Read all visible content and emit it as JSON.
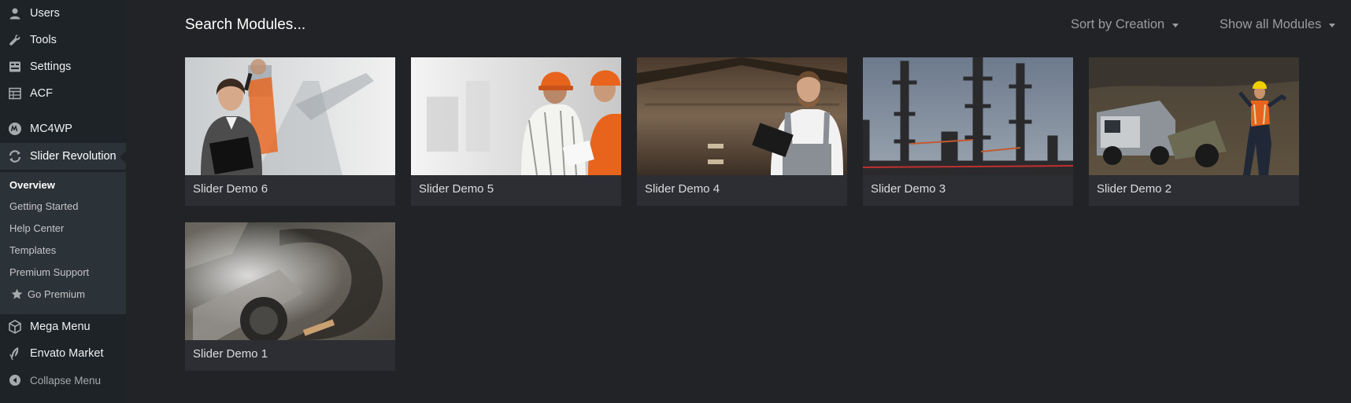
{
  "sidebar": {
    "items": [
      {
        "label": "Users",
        "icon": "user-icon"
      },
      {
        "label": "Tools",
        "icon": "wrench-icon"
      },
      {
        "label": "Settings",
        "icon": "settings-icon"
      },
      {
        "label": "ACF",
        "icon": "table-icon"
      },
      {
        "label": "MC4WP",
        "icon": "mc4wp-icon"
      },
      {
        "label": "Slider Revolution",
        "icon": "refresh-icon"
      },
      {
        "label": "Mega Menu",
        "icon": "cube-icon"
      },
      {
        "label": "Envato Market",
        "icon": "leaf-icon"
      },
      {
        "label": "Collapse Menu",
        "icon": "collapse-icon"
      }
    ],
    "submenu": [
      {
        "label": "Overview"
      },
      {
        "label": "Getting Started"
      },
      {
        "label": "Help Center"
      },
      {
        "label": "Templates"
      },
      {
        "label": "Premium Support"
      },
      {
        "label": "Go Premium",
        "icon": "star-icon"
      }
    ]
  },
  "header": {
    "search_label": "Search Modules...",
    "sort_label": "Sort by Creation",
    "filter_label": "Show all Modules"
  },
  "modules": [
    {
      "title": "Slider Demo 6"
    },
    {
      "title": "Slider Demo 5"
    },
    {
      "title": "Slider Demo 4"
    },
    {
      "title": "Slider Demo 3"
    },
    {
      "title": "Slider Demo 2"
    },
    {
      "title": "Slider Demo 1"
    }
  ],
  "colors": {
    "sidebar_bg": "#1d2327",
    "page_bg": "#222326",
    "card_bg": "#2d2e33",
    "accent_orange": "#e8641c"
  }
}
